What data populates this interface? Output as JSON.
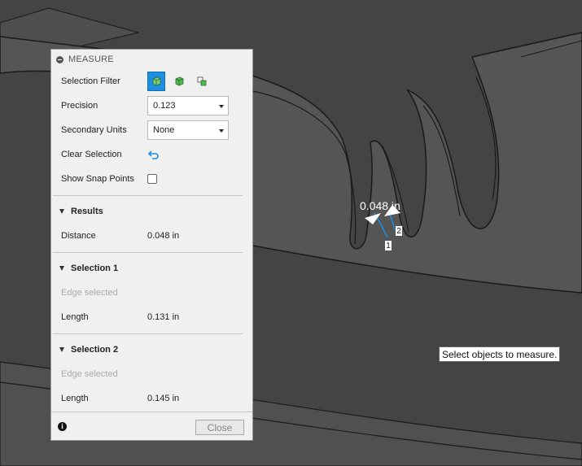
{
  "panel": {
    "title": "MEASURE",
    "selection_filter_label": "Selection Filter",
    "precision_label": "Precision",
    "precision_value": "0.123",
    "secondary_units_label": "Secondary Units",
    "secondary_units_value": "None",
    "clear_selection_label": "Clear Selection",
    "show_snap_points_label": "Show Snap Points",
    "show_snap_points_checked": false,
    "results": {
      "heading": "Results",
      "distance_label": "Distance",
      "distance_value": "0.048 in"
    },
    "selection1": {
      "heading": "Selection 1",
      "type_text": "Edge selected",
      "length_label": "Length",
      "length_value": "0.131 in"
    },
    "selection2": {
      "heading": "Selection 2",
      "type_text": "Edge selected",
      "length_label": "Length",
      "length_value": "0.145 in"
    },
    "close_label": "Close"
  },
  "canvas": {
    "measurement_label": "0.048 in",
    "point1_label": "1",
    "point2_label": "2",
    "tooltip": "Select objects to measure.",
    "colors": {
      "background": "#444444",
      "part_face": "#555555",
      "part_edge": "#1a1a1a",
      "accent": "#1d8fe0"
    }
  },
  "icons": {
    "filter_body": "cube-outline-icon",
    "filter_face": "cube-solid-icon",
    "filter_component": "component-icon",
    "clear_selection": "undo-arrow-icon",
    "info": "info-icon"
  }
}
